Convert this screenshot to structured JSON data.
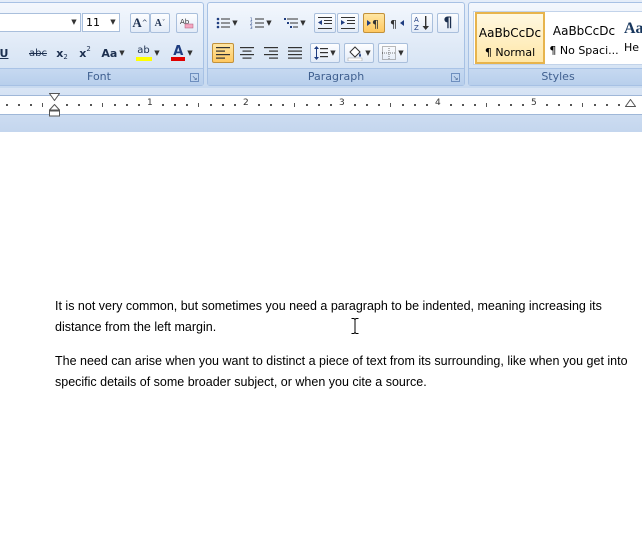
{
  "font_group": {
    "label": "Font",
    "font_size": "11",
    "grow_font": "A",
    "shrink_font": "A",
    "strikethrough": "abc",
    "subscript": "x",
    "superscript": "x",
    "change_case": "Aa",
    "highlight": "ab",
    "font_color": "A"
  },
  "paragraph_group": {
    "label": "Paragraph"
  },
  "styles_group": {
    "label": "Styles",
    "items": [
      {
        "sample": "AaBbCcDc",
        "name": "¶ Normal"
      },
      {
        "sample": "AaBbCcDc",
        "name": "¶ No Spaci..."
      },
      {
        "sample": "Aa",
        "name": "He"
      }
    ]
  },
  "ruler": {
    "numbers": [
      "1",
      "2",
      "3",
      "4",
      "5"
    ]
  },
  "document": {
    "paragraphs": [
      "It is not very common, but sometimes you need a paragraph to be indented, meaning increasing its distance from the left margin.",
      "The need can arise when you want to distinct a piece of text from its surrounding, like when you get into specific details of some broader subject, or when you cite a source."
    ]
  },
  "colors": {
    "highlight": "#ffff00",
    "font_color": "#e00000",
    "selected_style": "#ffe7a8"
  }
}
